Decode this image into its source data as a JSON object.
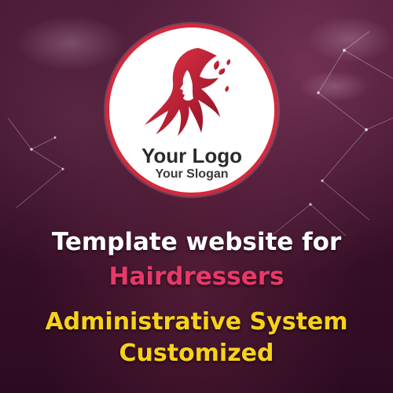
{
  "logo": {
    "name": "Your Logo",
    "slogan": "Your Slogan",
    "accent_color": "#d12a3e"
  },
  "headline": {
    "line_1": "Template website for",
    "line_2": "Hairdressers",
    "line_3": "Administrative System",
    "line_4": "Customized"
  },
  "colors": {
    "background": "#3a1129",
    "line_1": "#ffffff",
    "line_2": "#e8386a",
    "line_3": "#f7d21b"
  }
}
